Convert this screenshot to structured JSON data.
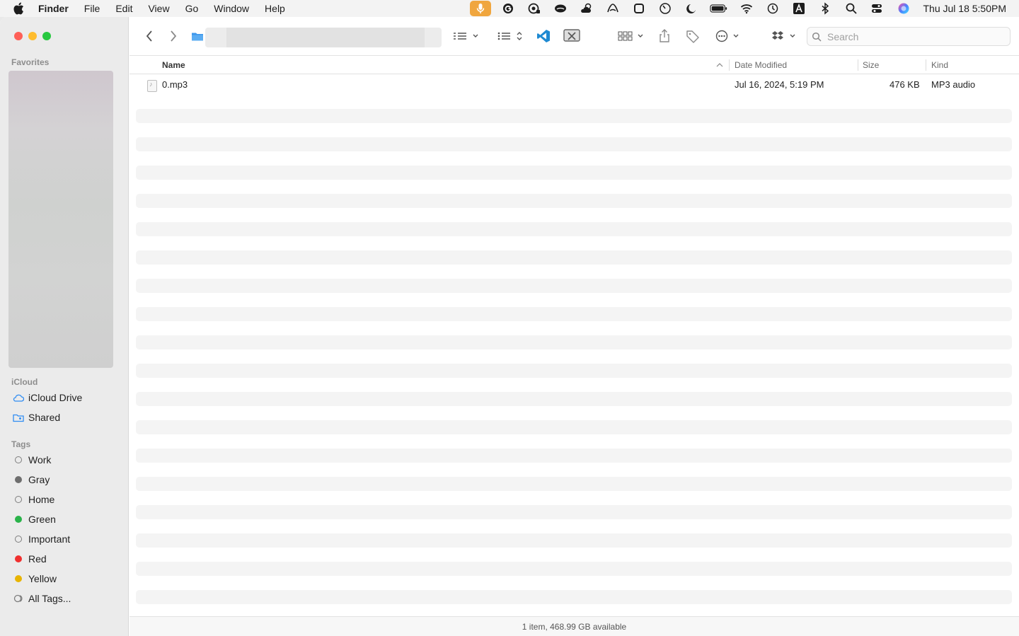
{
  "menubar": {
    "app_name": "Finder",
    "menus": [
      "File",
      "Edit",
      "View",
      "Go",
      "Window",
      "Help"
    ],
    "clock": "Thu Jul 18  5:50PM"
  },
  "sidebar": {
    "favorites_header": "Favorites",
    "icloud_header": "iCloud",
    "icloud_items": [
      {
        "label": "iCloud Drive",
        "icon": "cloud-icon"
      },
      {
        "label": "Shared",
        "icon": "shared-folder-icon"
      }
    ],
    "tags_header": "Tags",
    "tags": [
      {
        "label": "Work",
        "color": ""
      },
      {
        "label": "Gray",
        "color": "#6e6e6e"
      },
      {
        "label": "Home",
        "color": ""
      },
      {
        "label": "Green",
        "color": "#2ab34a"
      },
      {
        "label": "Important",
        "color": ""
      },
      {
        "label": "Red",
        "color": "#f0302f"
      },
      {
        "label": "Yellow",
        "color": "#e8b400"
      },
      {
        "label": "All Tags...",
        "color": ""
      }
    ]
  },
  "toolbar": {
    "search_placeholder": "Search"
  },
  "columns": {
    "name": "Name",
    "date_modified": "Date Modified",
    "size": "Size",
    "kind": "Kind"
  },
  "files": [
    {
      "name": "0.mp3",
      "date_modified": "Jul 16, 2024, 5:19 PM",
      "size": "476 KB",
      "kind": "MP3 audio"
    }
  ],
  "status_bar": "1 item, 468.99 GB available",
  "colors": {
    "accent": "#0a84ff",
    "mic_active": "#f0a63e"
  }
}
